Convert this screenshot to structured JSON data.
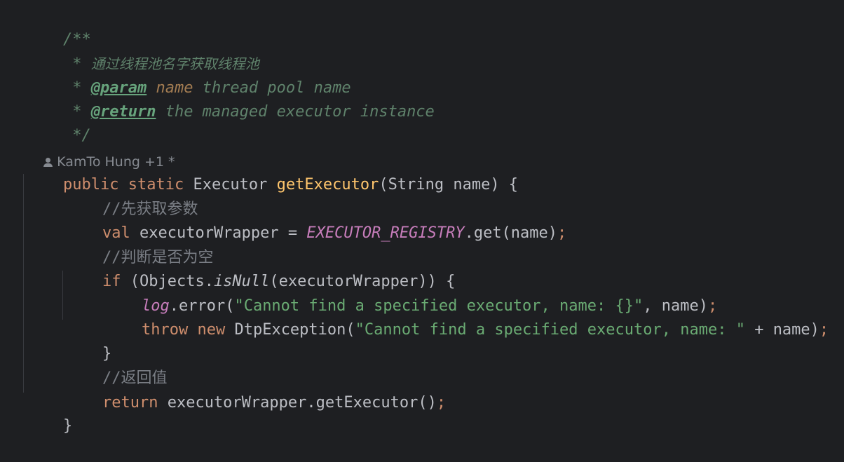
{
  "doc": {
    "open": "/**",
    "star": " * ",
    "desc": "通过线程池名字获取线程池",
    "param_tag": "@param",
    "param_name": "name",
    "param_desc": " thread pool name",
    "return_tag": "@return",
    "return_desc": " the managed executor instance",
    "close": " */"
  },
  "inlay": {
    "author": "KamTo Hung +1 *"
  },
  "code": {
    "sig_public": "public",
    "sig_static": "static",
    "sig_type": "Executor",
    "sig_name": "getExecutor",
    "sig_params": "(String name) {",
    "c1": "//先获取参数",
    "val_kw": "val",
    "val_var": " executorWrapper = ",
    "registry": "EXECUTOR_REGISTRY",
    "get_call": ".get(name)",
    "c2": "//判断是否为空",
    "if_kw": "if",
    "if_open": " (Objects.",
    "is_null": "isNull",
    "if_close": "(executorWrapper)) {",
    "log": "log",
    "log_error": ".error(",
    "log_str": "\"Cannot find a specified executor, name: {}\"",
    "log_rest": ", name)",
    "throw_kw": "throw",
    "new_kw": "new",
    "exc_open": " DtpException(",
    "exc_str": "\"Cannot find a specified executor, name: \"",
    "exc_rest": " + name)",
    "close_if": "}",
    "c3": "//返回值",
    "return_kw": "return",
    "return_expr": " executorWrapper.getExecutor()",
    "semi": ";",
    "close_method": "}"
  }
}
